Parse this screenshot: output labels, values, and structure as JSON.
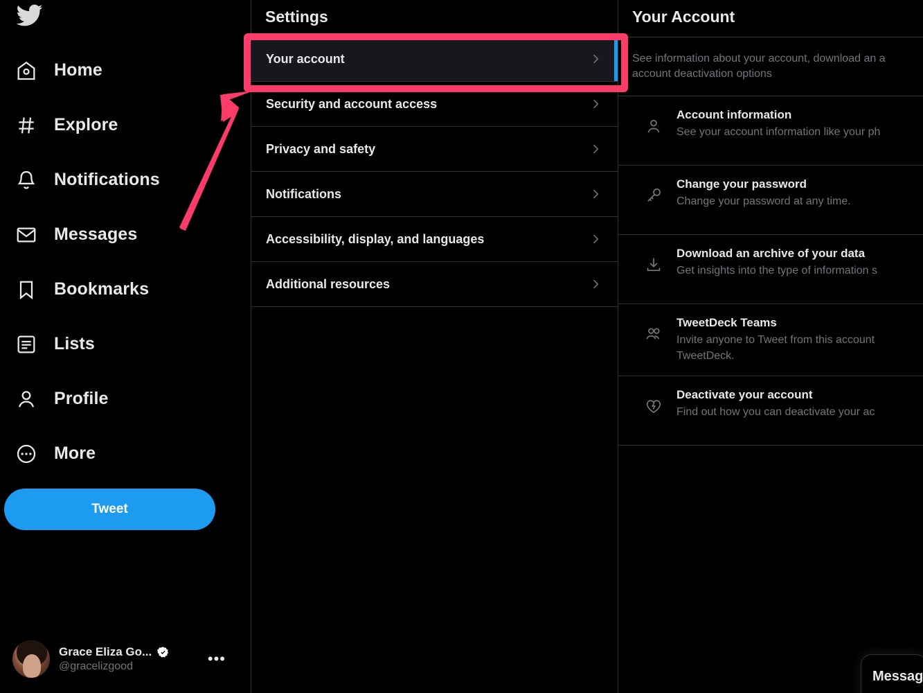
{
  "sidebar": {
    "logo_icon": "twitter-bird-icon",
    "items": [
      {
        "label": "Home",
        "icon": "home-icon"
      },
      {
        "label": "Explore",
        "icon": "hashtag-icon"
      },
      {
        "label": "Notifications",
        "icon": "bell-icon"
      },
      {
        "label": "Messages",
        "icon": "envelope-icon"
      },
      {
        "label": "Bookmarks",
        "icon": "bookmark-icon"
      },
      {
        "label": "Lists",
        "icon": "list-icon"
      },
      {
        "label": "Profile",
        "icon": "person-icon"
      },
      {
        "label": "More",
        "icon": "more-circle-icon"
      }
    ],
    "tweet_button": "Tweet",
    "profile": {
      "name": "Grace Eliza Go...",
      "handle": "@gracelizgood",
      "verified_icon": "verified-badge-icon",
      "more_icon": "ellipsis-icon"
    }
  },
  "settings": {
    "title": "Settings",
    "items": [
      {
        "label": "Your account",
        "selected": true
      },
      {
        "label": "Security and account access",
        "selected": false
      },
      {
        "label": "Privacy and safety",
        "selected": false
      },
      {
        "label": "Notifications",
        "selected": false
      },
      {
        "label": "Accessibility, display, and languages",
        "selected": false
      },
      {
        "label": "Additional resources",
        "selected": false
      }
    ]
  },
  "your_account": {
    "title": "Your Account",
    "description": "See information about your account, download an a\naccount deactivation options",
    "rows": [
      {
        "icon": "person-icon",
        "title": "Account information",
        "subtitle": "See your account information like your ph"
      },
      {
        "icon": "key-icon",
        "title": "Change your password",
        "subtitle": "Change your password at any time."
      },
      {
        "icon": "download-icon",
        "title": "Download an archive of your data",
        "subtitle": "Get insights into the type of information s"
      },
      {
        "icon": "people-icon",
        "title": "TweetDeck Teams",
        "subtitle": "Invite anyone to Tweet from this account\nTweetDeck."
      },
      {
        "icon": "broken-heart-icon",
        "title": "Deactivate your account",
        "subtitle": "Find out how you can deactivate your ac"
      }
    ]
  },
  "dock": {
    "messages_label": "Messages"
  },
  "annotation": {
    "highlight_color": "#fb3b68",
    "arrow_color": "#fb3b68",
    "target": "Your account",
    "selected_indicator_color": "#1d9bf0"
  },
  "colors": {
    "background": "#000000",
    "accent_blue": "#1d9bf0",
    "text_primary": "#e7e9ea",
    "text_secondary": "#71767b",
    "divider": "#2f3336",
    "row_selected_bg": "#16181c"
  }
}
